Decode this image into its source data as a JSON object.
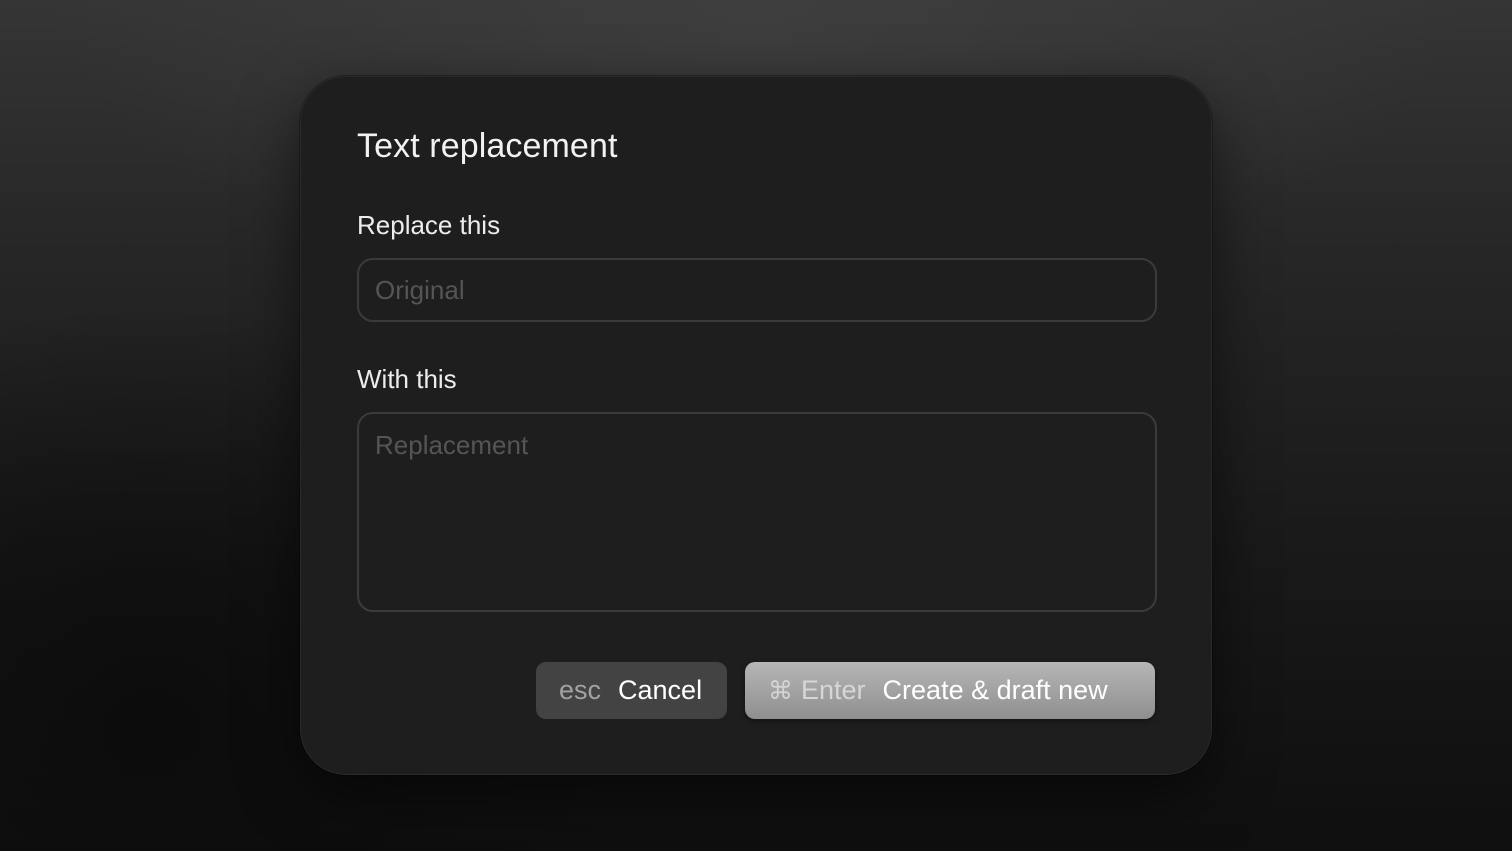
{
  "dialog": {
    "title": "Text replacement",
    "replace_label": "Replace this",
    "replace_placeholder": "Original",
    "with_label": "With this",
    "with_placeholder": "Replacement"
  },
  "buttons": {
    "cancel": {
      "shortcut": "esc",
      "label": "Cancel"
    },
    "create": {
      "shortcut_symbol": "⌘",
      "shortcut": "Enter",
      "label": "Create & draft new"
    }
  },
  "colors": {
    "dialog_background": "#1e1e1e",
    "input_border": "#3b3b3b",
    "cancel_button": "#434343",
    "primary_button": "#a3a3a3"
  },
  "icons": {
    "command": "command-key-icon"
  }
}
